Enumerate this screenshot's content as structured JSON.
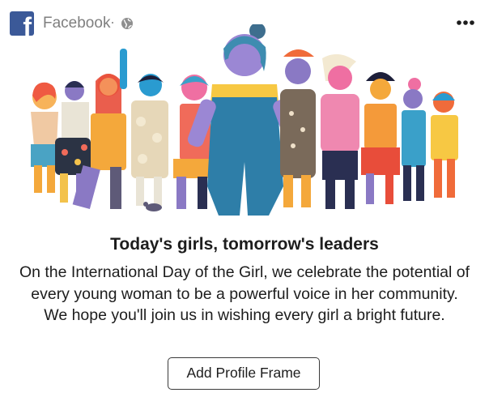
{
  "header": {
    "page_name": "Facebook",
    "separator": "·",
    "logo_letter": "f",
    "audience_icon": "globe-icon",
    "more_icon": "more-options-icon"
  },
  "illustration": {
    "subject": "group-of-diverse-girls-illustration"
  },
  "post": {
    "headline": "Today's girls, tomorrow's leaders",
    "body": "On the International Day of the Girl, we celebrate the potential of every young woman to be a powerful voice in her community. We hope you'll join us in wishing every girl a bright future.",
    "cta_label": "Add Profile Frame"
  },
  "colors": {
    "brand": "#3b5998",
    "text": "#1d1d1d",
    "muted": "#7f7f7f"
  }
}
